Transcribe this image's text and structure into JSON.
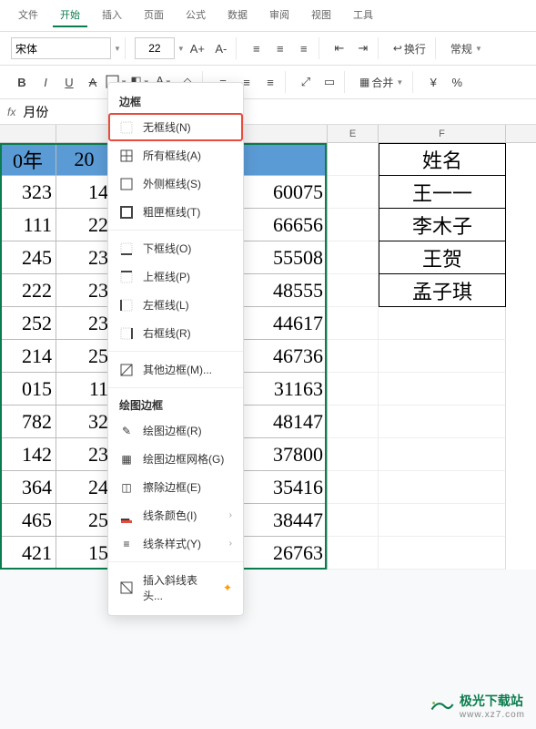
{
  "ribbon": {
    "tabs": [
      "文件",
      "开始",
      "插入",
      "页面",
      "公式",
      "数据",
      "审阅",
      "视图",
      "工具"
    ],
    "active": "开始"
  },
  "toolbar": {
    "font_name": "宋体",
    "font_size": "22",
    "increase_font": "A+",
    "decrease_font": "A-",
    "bold": "B",
    "italic": "I",
    "underline": "U",
    "strike": "S",
    "wrap_label": "换行",
    "merge_label": "合并",
    "format_label": "常规",
    "currency": "¥",
    "percent": "%"
  },
  "formula": {
    "fx": "fx",
    "value": "月份"
  },
  "columns": {
    "e": "E",
    "f": "F"
  },
  "chart_data": {
    "type": "table",
    "header_row": [
      "0年",
      "20"
    ],
    "rows": [
      [
        "323",
        "14",
        "60075"
      ],
      [
        "111",
        "22",
        "66656"
      ],
      [
        "245",
        "23",
        "55508"
      ],
      [
        "222",
        "23",
        "48555"
      ],
      [
        "252",
        "23",
        "44617"
      ],
      [
        "214",
        "25",
        "46736"
      ],
      [
        "015",
        "11",
        "31163"
      ],
      [
        "782",
        "32",
        "48147"
      ],
      [
        "142",
        "23",
        "37800"
      ],
      [
        "364",
        "24",
        "35416"
      ],
      [
        "465",
        "25",
        "38447"
      ],
      [
        "421",
        "15",
        "26763"
      ]
    ],
    "side_table": [
      "姓名",
      "王一一",
      "李木子",
      "王贺",
      "孟子琪"
    ]
  },
  "dropdown": {
    "section1": "边框",
    "items1": [
      {
        "label": "无框线(N)",
        "icon": "none",
        "hl": true
      },
      {
        "label": "所有框线(A)",
        "icon": "all"
      },
      {
        "label": "外侧框线(S)",
        "icon": "outer"
      },
      {
        "label": "粗匣框线(T)",
        "icon": "thick"
      }
    ],
    "items2": [
      {
        "label": "下框线(O)",
        "icon": "bottom"
      },
      {
        "label": "上框线(P)",
        "icon": "top"
      },
      {
        "label": "左框线(L)",
        "icon": "left"
      },
      {
        "label": "右框线(R)",
        "icon": "right"
      }
    ],
    "items3": [
      {
        "label": "其他边框(M)...",
        "icon": "more"
      }
    ],
    "section2": "绘图边框",
    "items4": [
      {
        "label": "绘图边框(R)",
        "icon": "draw"
      },
      {
        "label": "绘图边框网格(G)",
        "icon": "grid"
      },
      {
        "label": "擦除边框(E)",
        "icon": "erase"
      },
      {
        "label": "线条颜色(I)",
        "icon": "color",
        "arrow": true
      },
      {
        "label": "线条样式(Y)",
        "icon": "style",
        "arrow": true
      }
    ],
    "items5": [
      {
        "label": "插入斜线表头...",
        "icon": "diag",
        "star": true
      }
    ]
  },
  "watermark": {
    "brand": "极光下载站",
    "sub": "www.xz7.com"
  }
}
